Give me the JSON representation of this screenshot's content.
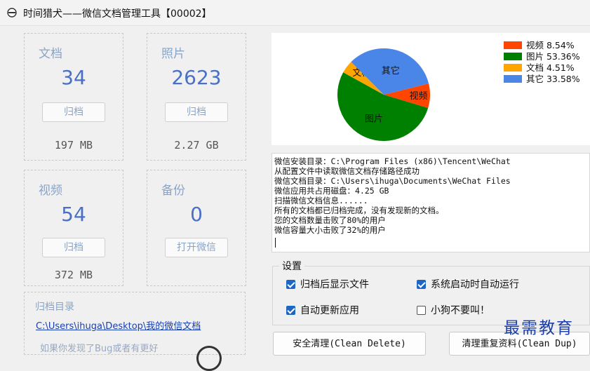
{
  "window": {
    "title": "时间猎犬——微信文档管理工具【00002】"
  },
  "cards": [
    {
      "label": "文档",
      "count": "34",
      "button": "归档",
      "size": "197 MB"
    },
    {
      "label": "照片",
      "count": "2623",
      "button": "归档",
      "size": "2.27 GB"
    },
    {
      "label": "视频",
      "count": "54",
      "button": "归档",
      "size": "372 MB"
    },
    {
      "label": "备份",
      "count": "0",
      "button": "打开微信",
      "size": ""
    }
  ],
  "archive_dir": {
    "label": "归档目录",
    "path": "C:\\Users\\ihuga\\Desktop\\我的微信文档",
    "hint": "如果你发现了Bug或者有更好"
  },
  "chart_data": {
    "type": "pie",
    "slices": [
      {
        "label": "视频",
        "value": 8.54,
        "legend": "视频 8.54%",
        "color": "#ff4500"
      },
      {
        "label": "图片",
        "value": 53.36,
        "legend": "图片 53.36%",
        "color": "#008000"
      },
      {
        "label": "文档",
        "value": 4.51,
        "legend": "文档 4.51%",
        "color": "#ffa500"
      },
      {
        "label": "其它",
        "value": 33.58,
        "legend": "其它 33.58%",
        "color": "#4a86e8"
      }
    ],
    "legend_position": "top-right"
  },
  "console": {
    "lines": [
      "微信安装目录：C:\\Program Files (x86)\\Tencent\\WeChat",
      "从配置文件中读取微信文档存储路径成功",
      "微信文档目录：C:\\Users\\ihuga\\Documents\\WeChat Files",
      "微信应用共占用磁盘：4.25 GB",
      "扫描微信文档信息......",
      "所有的文档都已归档完成，没有发现新的文档。",
      "您的文档数量击败了80%的用户",
      "微信容量大小击败了32%的用户"
    ]
  },
  "settings": {
    "title": "设置",
    "options": [
      {
        "label": "归档后显示文件",
        "checked": true
      },
      {
        "label": "系统启动时自动运行",
        "checked": true
      },
      {
        "label": "自动更新应用",
        "checked": true
      },
      {
        "label": "小狗不要叫！",
        "checked": false
      }
    ]
  },
  "actions": {
    "clean_delete": "安全清理(Clean Delete)",
    "clean_dup": "清理重复资料(Clean Dup)"
  },
  "watermark": "最需教育"
}
